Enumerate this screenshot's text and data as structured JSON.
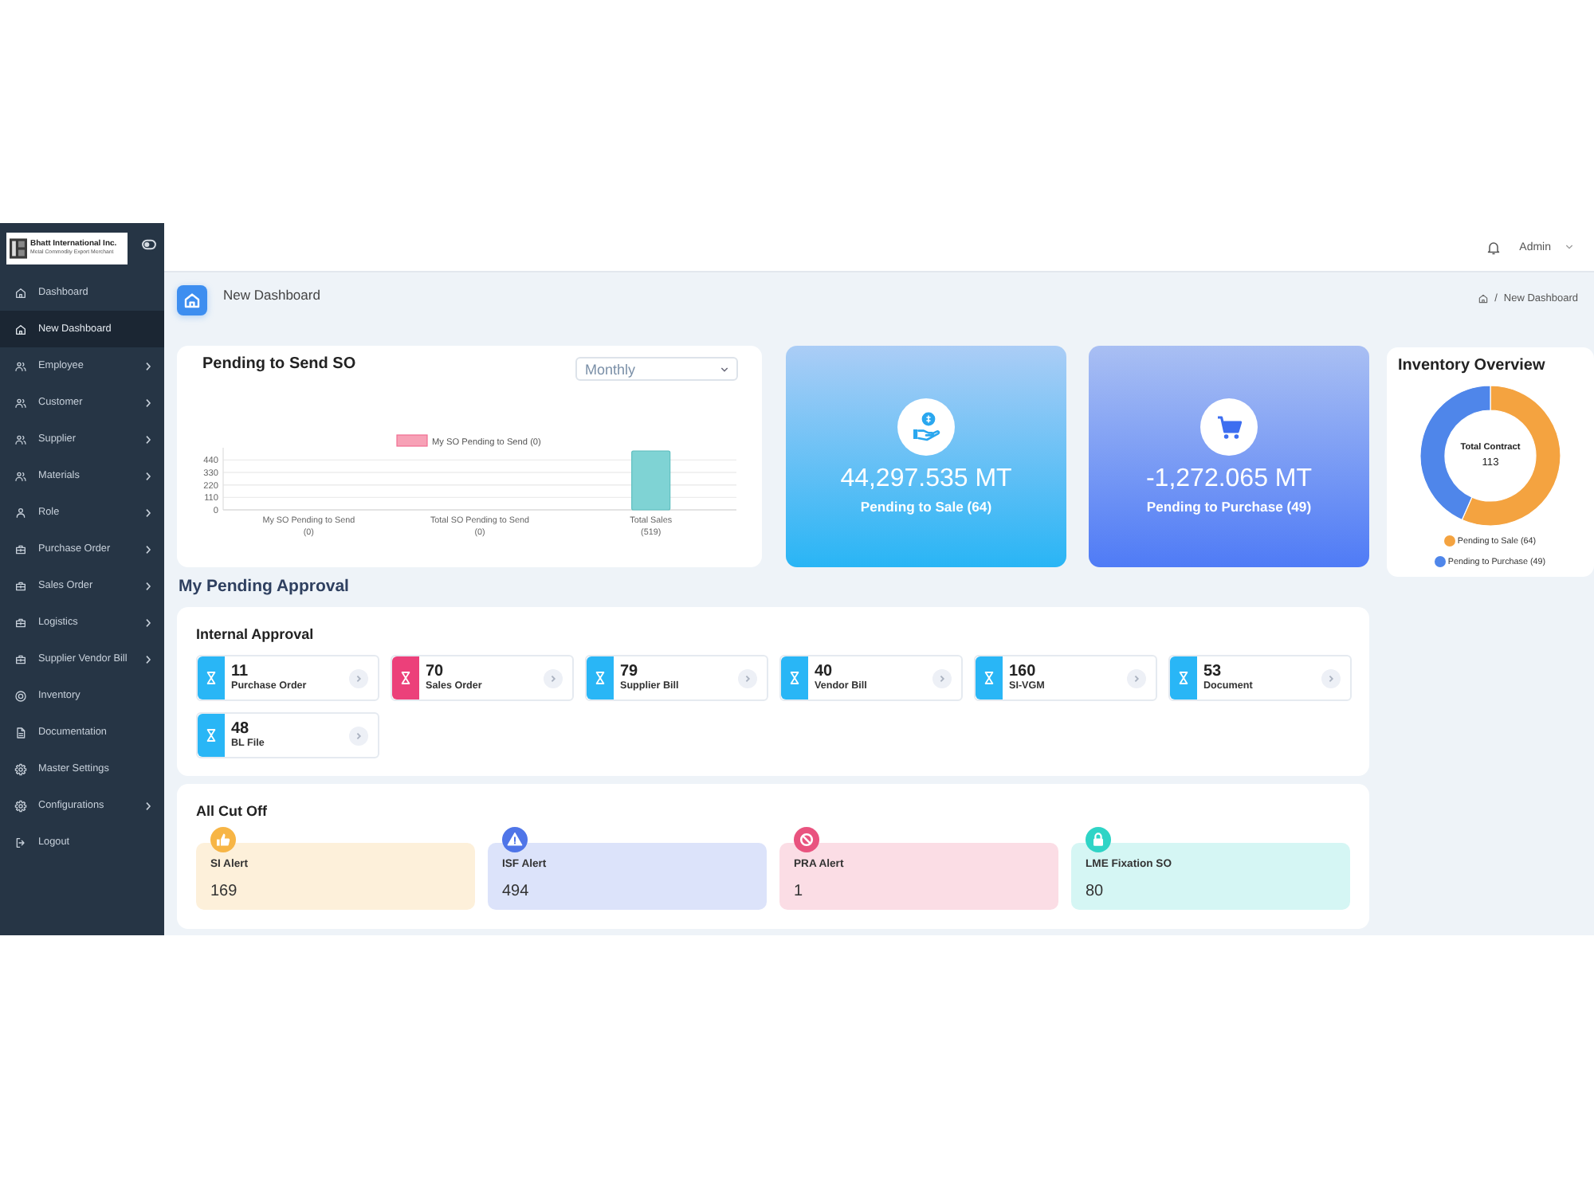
{
  "sidebar": {
    "logo": {
      "name": "Bhatt International Inc.",
      "tagline": "Metal Commodity Export Merchant"
    },
    "items": [
      {
        "label": "Dashboard",
        "kind": "home",
        "submenu": false,
        "selected": false
      },
      {
        "label": "New Dashboard",
        "kind": "home",
        "submenu": false,
        "selected": true
      },
      {
        "label": "Employee",
        "kind": "group",
        "submenu": true,
        "selected": false
      },
      {
        "label": "Customer",
        "kind": "group",
        "submenu": true,
        "selected": false
      },
      {
        "label": "Supplier",
        "kind": "group",
        "submenu": true,
        "selected": false
      },
      {
        "label": "Materials",
        "kind": "group",
        "submenu": true,
        "selected": false
      },
      {
        "label": "Role",
        "kind": "person",
        "submenu": true,
        "selected": false
      },
      {
        "label": "Purchase Order",
        "kind": "case",
        "submenu": true,
        "selected": false
      },
      {
        "label": "Sales Order",
        "kind": "case",
        "submenu": true,
        "selected": false
      },
      {
        "label": "Logistics",
        "kind": "case",
        "submenu": true,
        "selected": false
      },
      {
        "label": "Supplier Vendor Bill",
        "kind": "case",
        "submenu": true,
        "selected": false
      },
      {
        "label": "Inventory",
        "kind": "disc",
        "submenu": false,
        "selected": false
      },
      {
        "label": "Documentation",
        "kind": "doc",
        "submenu": false,
        "selected": false
      },
      {
        "label": "Master Settings",
        "kind": "settings",
        "submenu": false,
        "selected": false
      },
      {
        "label": "Configurations",
        "kind": "settings",
        "submenu": true,
        "selected": false
      },
      {
        "label": "Logout",
        "kind": "exit",
        "submenu": false,
        "selected": false
      }
    ]
  },
  "topbar": {
    "user": "Admin"
  },
  "page_header": {
    "title": "New Dashboard",
    "breadcrumb": {
      "separator": "/",
      "current": "New Dashboard"
    }
  },
  "pending_so": {
    "title": "Pending to Send SO",
    "period": "Monthly",
    "legend": {
      "color": "#f7a1b6"
    },
    "chart_data": {
      "type": "bar",
      "categories": [
        "My SO Pending to Send (0)",
        "Total SO Pending to Send (0)",
        "Total Sales (519)"
      ],
      "series": [
        {
          "name": "My SO Pending to Send (0)",
          "color": "#7fd3d4",
          "values": [
            0,
            0,
            519
          ]
        }
      ],
      "ylim": [
        0,
        520
      ],
      "yticks": [
        0,
        110,
        220,
        330,
        440
      ],
      "grid": true
    }
  },
  "stats": [
    {
      "kind": "sale",
      "value": "44,297.535 MT",
      "label": "Pending to Sale (64)"
    },
    {
      "kind": "purchase",
      "value": "-1,272.065 MT",
      "label": "Pending to Purchase (49)"
    }
  ],
  "inventory": {
    "title": "Inventory Overview",
    "center_label": "Total Contract",
    "center_value": "113",
    "chart_data": {
      "type": "donut",
      "categories": [
        "Pending to Sale (64)",
        "Pending to Purchase (49)"
      ],
      "values": [
        64,
        49
      ],
      "colors": [
        "#f4a340",
        "#4f86ea"
      ]
    }
  },
  "approvals": {
    "heading": "My Pending Approval",
    "internal": {
      "title": "Internal Approval",
      "tiles": [
        {
          "count": "11",
          "label": "Purchase Order",
          "color": "#29b6f6"
        },
        {
          "count": "70",
          "label": "Sales Order",
          "color": "#ec407a"
        },
        {
          "count": "79",
          "label": "Supplier Bill",
          "color": "#29b6f6"
        },
        {
          "count": "40",
          "label": "Vendor Bill",
          "color": "#29b6f6"
        },
        {
          "count": "160",
          "label": "SI-VGM",
          "color": "#29b6f6"
        },
        {
          "count": "53",
          "label": "Document",
          "color": "#29b6f6"
        },
        {
          "count": "48",
          "label": "BL File",
          "color": "#29b6f6"
        }
      ]
    },
    "cut_off": {
      "title": "All Cut Off",
      "alerts": [
        {
          "kind": "like",
          "label": "SI Alert",
          "value": "169",
          "color": "#f7b545"
        },
        {
          "kind": "warning",
          "label": "ISF Alert",
          "value": "494",
          "color": "#4f75e8"
        },
        {
          "kind": "blocked",
          "label": "PRA Alert",
          "value": "1",
          "color": "#e9537f"
        },
        {
          "kind": "lock",
          "label": "LME Fixation SO",
          "value": "80",
          "color": "#2fd4c6"
        }
      ]
    }
  }
}
